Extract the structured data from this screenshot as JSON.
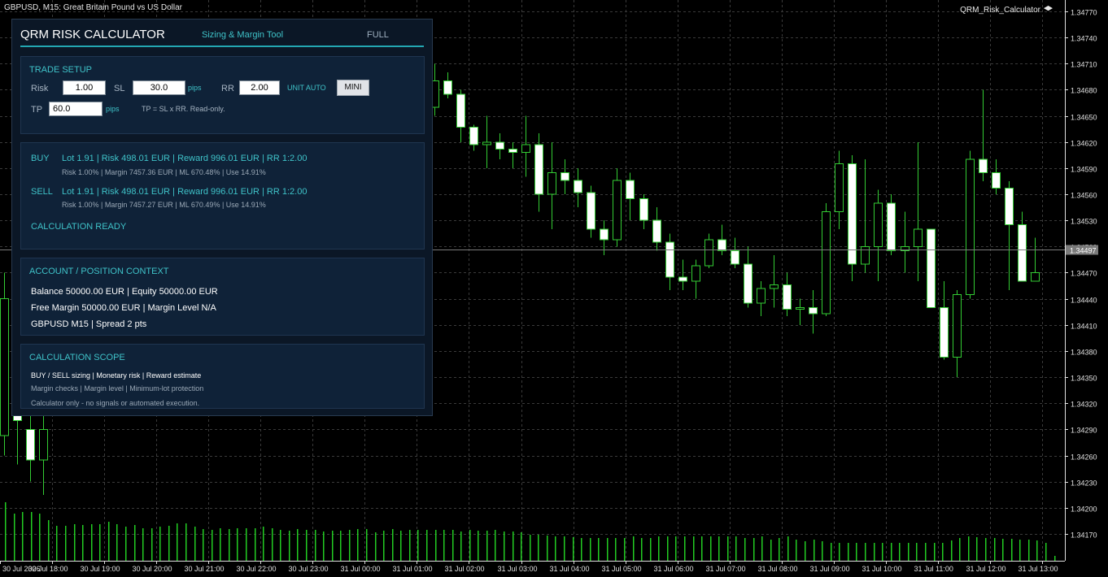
{
  "window": {
    "symbol_title": "GBPUSD, M15:  Great Britain Pound vs US Dollar",
    "indicator_title": "QRM_Risk_Calculator",
    "current_price_label": "1.34497"
  },
  "panel": {
    "title": "QRM RISK CALCULATOR",
    "subtitle": "Sizing & Margin Tool",
    "mode_label": "FULL",
    "trade_setup": {
      "title": "TRADE SETUP",
      "risk_label": "Risk",
      "risk_value": "1.00",
      "sl_label": "SL",
      "sl_value": "30.0",
      "sl_unit": "pips",
      "rr_label": "RR",
      "rr_value": "2.00",
      "unit_mode": "UNIT AUTO",
      "mini_button": "MINI",
      "tp_label": "TP",
      "tp_value": "60.0",
      "tp_unit": "pips",
      "tp_note": "TP = SL x RR. Read-only."
    },
    "results": {
      "buy_label": "BUY",
      "buy_main": "Lot 1.91 | Risk 498.01 EUR | Reward 996.01 EUR | RR 1:2.00",
      "buy_detail": "Risk 1.00% | Margin 7457.36 EUR | ML 670.48% | Use 14.91%",
      "sell_label": "SELL",
      "sell_main": "Lot 1.91 | Risk 498.01 EUR | Reward 996.01 EUR | RR 1:2.00",
      "sell_detail": "Risk 1.00% | Margin 7457.27 EUR | ML 670.49% | Use 14.91%",
      "status": "CALCULATION READY"
    },
    "account": {
      "title": "ACCOUNT / POSITION CONTEXT",
      "line1": "Balance 50000.00 EUR | Equity 50000.00 EUR",
      "line2": "Free Margin 50000.00 EUR | Margin Level N/A",
      "line3": "GBPUSD M15 | Spread 2 pts"
    },
    "scope": {
      "title": "CALCULATION SCOPE",
      "line1": "BUY / SELL sizing  |  Monetary risk  |  Reward estimate",
      "line2": "Margin checks  |  Margin level  |  Minimum-lot protection",
      "footer": "Calculator only - no signals or automated execution."
    }
  },
  "chart_data": {
    "type": "candlestick",
    "symbol": "GBPUSD",
    "timeframe": "M15",
    "price_range": [
      1.34137,
      1.34787
    ],
    "y_ticks": [
      "1.34770",
      "1.34740",
      "1.34710",
      "1.34680",
      "1.34650",
      "1.34620",
      "1.34590",
      "1.34560",
      "1.34530",
      "1.34500",
      "1.34470",
      "1.34440",
      "1.34410",
      "1.34380",
      "1.34350",
      "1.34320",
      "1.34290",
      "1.34260",
      "1.34230",
      "1.34200",
      "1.34170"
    ],
    "x_ticks": [
      "30 Jul 2026",
      "30 Jul 18:00",
      "30 Jul 19:00",
      "30 Jul 20:00",
      "30 Jul 21:00",
      "30 Jul 22:00",
      "30 Jul 23:00",
      "31 Jul 00:00",
      "31 Jul 01:00",
      "31 Jul 02:00",
      "31 Jul 03:00",
      "31 Jul 04:00",
      "31 Jul 05:00",
      "31 Jul 06:00",
      "31 Jul 07:00",
      "31 Jul 08:00",
      "31 Jul 09:00",
      "31 Jul 10:00",
      "31 Jul 11:00",
      "31 Jul 12:00",
      "31 Jul 13:00"
    ],
    "current_price": 1.34497,
    "colors": {
      "background": "#000000",
      "grid": "#3a3a3a",
      "bull": "#000000",
      "bear": "#ffffff",
      "wick": "#33cc33",
      "volume": "#22cc22",
      "axis_text": "#e0e0e0"
    },
    "candles": [
      {
        "o": 1.34283,
        "h": 1.3447,
        "l": 1.3426,
        "c": 1.3444
      },
      {
        "o": 1.344,
        "h": 1.3444,
        "l": 1.3425,
        "c": 1.343
      },
      {
        "o": 1.3429,
        "h": 1.3432,
        "l": 1.3423,
        "c": 1.34255
      },
      {
        "o": 1.34255,
        "h": 1.3431,
        "l": 1.34215,
        "c": 1.3429
      },
      {
        "o": 1.3466,
        "h": 1.3471,
        "l": 1.3465,
        "c": 1.3469
      },
      {
        "o": 1.3469,
        "h": 1.347,
        "l": 1.3467,
        "c": 1.34675
      },
      {
        "o": 1.34675,
        "h": 1.3468,
        "l": 1.3462,
        "c": 1.34637
      },
      {
        "o": 1.34637,
        "h": 1.3464,
        "l": 1.3461,
        "c": 1.34617
      },
      {
        "o": 1.34617,
        "h": 1.3465,
        "l": 1.3459,
        "c": 1.3462
      },
      {
        "o": 1.3462,
        "h": 1.3463,
        "l": 1.346,
        "c": 1.34612
      },
      {
        "o": 1.34612,
        "h": 1.3462,
        "l": 1.3459,
        "c": 1.34608
      },
      {
        "o": 1.34608,
        "h": 1.3465,
        "l": 1.3458,
        "c": 1.34617
      },
      {
        "o": 1.34617,
        "h": 1.3463,
        "l": 1.3454,
        "c": 1.3456
      },
      {
        "o": 1.3456,
        "h": 1.3462,
        "l": 1.3452,
        "c": 1.34585
      },
      {
        "o": 1.34585,
        "h": 1.346,
        "l": 1.3456,
        "c": 1.34576
      },
      {
        "o": 1.34576,
        "h": 1.3459,
        "l": 1.34545,
        "c": 1.34562
      },
      {
        "o": 1.34562,
        "h": 1.3457,
        "l": 1.3451,
        "c": 1.3452
      },
      {
        "o": 1.3452,
        "h": 1.3453,
        "l": 1.3449,
        "c": 1.34508
      },
      {
        "o": 1.34508,
        "h": 1.3459,
        "l": 1.345,
        "c": 1.34576
      },
      {
        "o": 1.34576,
        "h": 1.34585,
        "l": 1.3453,
        "c": 1.34555
      },
      {
        "o": 1.34555,
        "h": 1.3456,
        "l": 1.3452,
        "c": 1.3453
      },
      {
        "o": 1.3453,
        "h": 1.34545,
        "l": 1.34495,
        "c": 1.34505
      },
      {
        "o": 1.34505,
        "h": 1.34515,
        "l": 1.3445,
        "c": 1.34465
      },
      {
        "o": 1.34465,
        "h": 1.34485,
        "l": 1.3445,
        "c": 1.3446
      },
      {
        "o": 1.3446,
        "h": 1.34485,
        "l": 1.3444,
        "c": 1.34478
      },
      {
        "o": 1.34478,
        "h": 1.34515,
        "l": 1.34475,
        "c": 1.34508
      },
      {
        "o": 1.34508,
        "h": 1.34525,
        "l": 1.3449,
        "c": 1.34495
      },
      {
        "o": 1.34495,
        "h": 1.3451,
        "l": 1.34475,
        "c": 1.3448
      },
      {
        "o": 1.3448,
        "h": 1.345,
        "l": 1.3443,
        "c": 1.34435
      },
      {
        "o": 1.34435,
        "h": 1.3446,
        "l": 1.3442,
        "c": 1.34452
      },
      {
        "o": 1.34452,
        "h": 1.3449,
        "l": 1.3443,
        "c": 1.34456
      },
      {
        "o": 1.34456,
        "h": 1.3447,
        "l": 1.3442,
        "c": 1.34428
      },
      {
        "o": 1.34428,
        "h": 1.3444,
        "l": 1.3441,
        "c": 1.3443
      },
      {
        "o": 1.3443,
        "h": 1.3445,
        "l": 1.344,
        "c": 1.34423
      },
      {
        "o": 1.34423,
        "h": 1.3455,
        "l": 1.3442,
        "c": 1.3454
      },
      {
        "o": 1.3454,
        "h": 1.3461,
        "l": 1.3452,
        "c": 1.34595
      },
      {
        "o": 1.34595,
        "h": 1.34605,
        "l": 1.3446,
        "c": 1.3448
      },
      {
        "o": 1.3448,
        "h": 1.346,
        "l": 1.3447,
        "c": 1.345
      },
      {
        "o": 1.345,
        "h": 1.34565,
        "l": 1.3446,
        "c": 1.3455
      },
      {
        "o": 1.3455,
        "h": 1.3456,
        "l": 1.3449,
        "c": 1.34495
      },
      {
        "o": 1.34495,
        "h": 1.3454,
        "l": 1.3447,
        "c": 1.345
      },
      {
        "o": 1.345,
        "h": 1.3462,
        "l": 1.3446,
        "c": 1.3452
      },
      {
        "o": 1.3452,
        "h": 1.3452,
        "l": 1.3443,
        "c": 1.3443
      },
      {
        "o": 1.3443,
        "h": 1.3446,
        "l": 1.3437,
        "c": 1.34373
      },
      {
        "o": 1.34373,
        "h": 1.3445,
        "l": 1.3435,
        "c": 1.34445
      },
      {
        "o": 1.34445,
        "h": 1.3461,
        "l": 1.3444,
        "c": 1.346
      },
      {
        "o": 1.346,
        "h": 1.3468,
        "l": 1.34575,
        "c": 1.34585
      },
      {
        "o": 1.34585,
        "h": 1.346,
        "l": 1.3456,
        "c": 1.34567
      },
      {
        "o": 1.34567,
        "h": 1.34575,
        "l": 1.3445,
        "c": 1.34525
      },
      {
        "o": 1.34525,
        "h": 1.3454,
        "l": 1.3446,
        "c": 1.3446
      },
      {
        "o": 1.3446,
        "h": 1.3451,
        "l": 1.3446,
        "c": 1.3447
      }
    ],
    "volume_bars": [
      72,
      58,
      60,
      60,
      58,
      50,
      43,
      43,
      45,
      44,
      45,
      45,
      48,
      45,
      42,
      44,
      40,
      40,
      42,
      43,
      46,
      46,
      42,
      39,
      38,
      40,
      39,
      40,
      40,
      40,
      42,
      40,
      38,
      37,
      39,
      38,
      38,
      36,
      37,
      37,
      38,
      39,
      39,
      35,
      37,
      39,
      37,
      38,
      38,
      38,
      38,
      38,
      38,
      36,
      38,
      37,
      37,
      38,
      36,
      36,
      35,
      32,
      32,
      31,
      30,
      30,
      29,
      28,
      28,
      28,
      28,
      28,
      28,
      30,
      28,
      28,
      30,
      30,
      30,
      30,
      30,
      30,
      30,
      30,
      30,
      30,
      28,
      28,
      30,
      26,
      28,
      30,
      26,
      24,
      26,
      24,
      22,
      22,
      22,
      22,
      22,
      22,
      22,
      22,
      22,
      22,
      22,
      22,
      22,
      22,
      25,
      28,
      30,
      29,
      28,
      28,
      27,
      27,
      26,
      26,
      25,
      22,
      6,
      3,
      2,
      1
    ]
  }
}
